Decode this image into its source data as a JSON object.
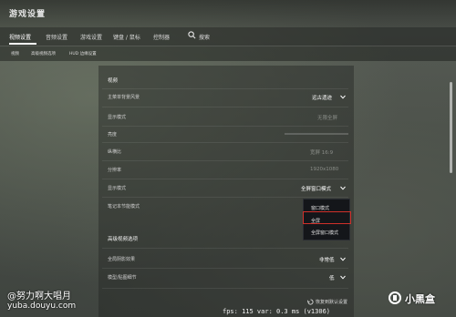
{
  "window": {
    "title": "游戏设置"
  },
  "tabs": [
    {
      "label": "视频设置",
      "active": true
    },
    {
      "label": "音频设置"
    },
    {
      "label": "游戏设置"
    },
    {
      "label": "键盘 / 鼠标"
    },
    {
      "label": "控制器"
    },
    {
      "label": "搜索"
    }
  ],
  "subtabs": [
    "视频",
    "高级视频选项",
    "HUD 边缘设置"
  ],
  "video": {
    "section_title": "视频",
    "rows": [
      {
        "label": "主菜单背景风景",
        "value": "远古遗迹",
        "dim": false
      },
      {
        "label": "显示模式",
        "value": "无限全屏",
        "dim": true
      },
      {
        "label": "亮度",
        "value": "",
        "dim": true
      },
      {
        "label": "纵横比",
        "value": "宽屏 16:9",
        "dim": true
      },
      {
        "label": "分辨率",
        "value": "1920x1080",
        "dim": true
      },
      {
        "label": "显示模式",
        "value": "全屏窗口模式",
        "dim": false
      },
      {
        "label": "笔记本节能模式",
        "value": "",
        "dim": true
      }
    ]
  },
  "dropdown": {
    "options": [
      "窗口模式",
      "全屏",
      "全屏窗口模式"
    ],
    "highlighted": "全屏"
  },
  "advanced": {
    "section_title": "高级视频选项",
    "rows": [
      {
        "label": "全局阴影效果",
        "value": "非常低"
      },
      {
        "label": "模型/贴图细节",
        "value": "低"
      }
    ]
  },
  "footer": {
    "reset_label": "恢复到默认设置",
    "fps_text": "fps:    115 var:  0.3 ms (v1306)"
  },
  "watermark": {
    "name": "@努力啊大唱月",
    "url": "yuba.douyu.com",
    "logo": "小黑盒"
  },
  "colors": {
    "highlight": "#d0302a",
    "accent": "#ffffff"
  }
}
